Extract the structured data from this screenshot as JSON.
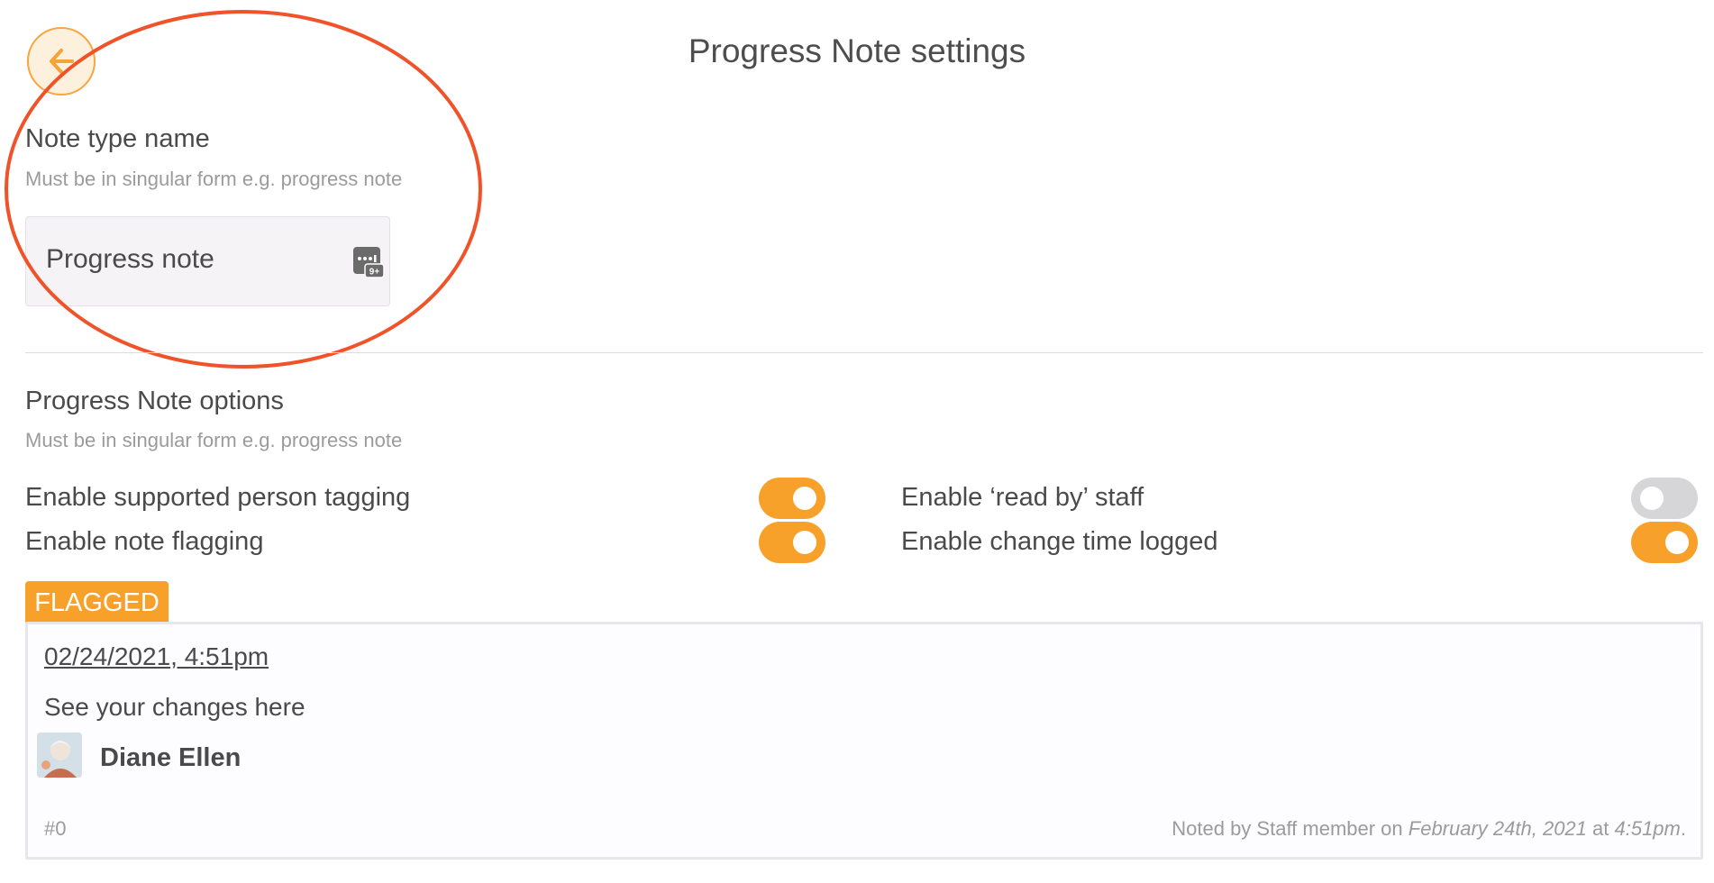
{
  "header": {
    "title": "Progress Note settings",
    "back_icon": "arrow-left-icon"
  },
  "note_type": {
    "label": "Note type name",
    "hint": "Must be in singular form e.g. progress note",
    "value": "Progress note",
    "field_icon": "keyboard-password-icon"
  },
  "options": {
    "label": "Progress Note options",
    "hint": "Must be in singular form e.g. progress note",
    "items": [
      {
        "label": "Enable supported person tagging",
        "enabled": true
      },
      {
        "label": "Enable note flagging",
        "enabled": true
      },
      {
        "label": "Enable ‘read by’ staff",
        "enabled": false
      },
      {
        "label": "Enable change time logged",
        "enabled": true
      }
    ]
  },
  "preview": {
    "badge": "FLAGGED",
    "date": "02/24/2021, 4:51pm",
    "body": "See your changes here",
    "person_name": "Diane Ellen",
    "note_id": "#0",
    "meta_prefix": "Noted by Staff member on ",
    "meta_date": "February 24th, 2021",
    "meta_at": " at ",
    "meta_time": "4:51pm",
    "meta_suffix": "."
  },
  "colors": {
    "accent": "#f7a12a",
    "toggle_on": "#f7a12a",
    "toggle_off": "#d6d5d8",
    "annotation": "#f0532a"
  }
}
